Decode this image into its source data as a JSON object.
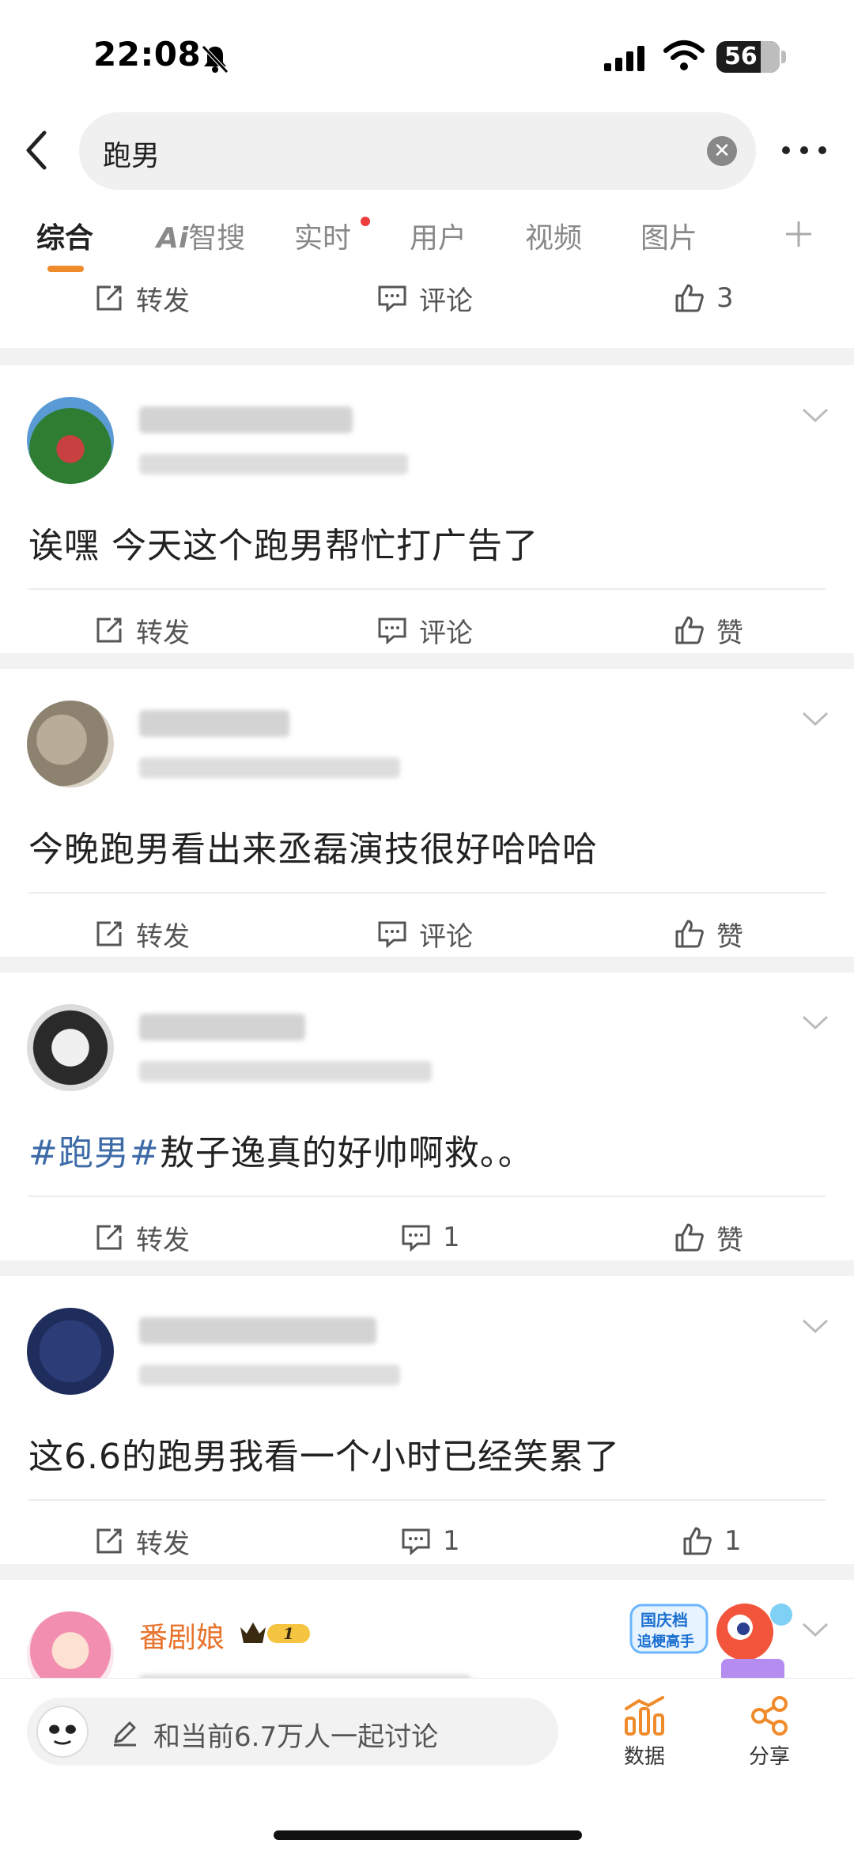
{
  "status": {
    "time": "22:08",
    "battery": "56"
  },
  "search": {
    "query": "跑男"
  },
  "tabs": [
    {
      "label": "综合",
      "active": true
    },
    {
      "label": "Ai智搜",
      "ai_mark": "Ai",
      "rest": "智搜"
    },
    {
      "label": "实时",
      "has_dot": true
    },
    {
      "label": "用户"
    },
    {
      "label": "视频"
    },
    {
      "label": "图片"
    }
  ],
  "actions": {
    "repost": "转发",
    "comment": "评论",
    "like": "赞"
  },
  "partial_card": {
    "like_count": "3"
  },
  "posts": [
    {
      "text": "诶嘿 今天这个跑男帮忙打广告了"
    },
    {
      "text": "今晚跑男看出来丞磊演技很好哈哈哈"
    },
    {
      "hashtag": "#跑男#",
      "text": "敖子逸真的好帅啊救。。",
      "comment_count": "1"
    },
    {
      "text": "这6.6的跑男我看一个小时已经笑累了",
      "comment_count": "1",
      "like_count": "1"
    }
  ],
  "last_post": {
    "name": "番剧娘",
    "vip_level": "1",
    "promo_text_1": "国庆档",
    "promo_text_2": "追梗高手"
  },
  "bottom_bar": {
    "discuss_placeholder": "和当前6.7万人一起讨论",
    "data_label": "数据",
    "share_label": "分享"
  },
  "colors": {
    "accent": "#f08b2b",
    "hashtag": "#3e6ba7",
    "vip_name": "#e8732c"
  },
  "icons": [
    "bell-mute-icon",
    "signal-icon",
    "wifi-icon",
    "back-icon",
    "clear-icon",
    "more-icon",
    "plus-icon",
    "repost-icon",
    "comment-icon",
    "like-icon",
    "chevron-down-icon",
    "pencil-icon",
    "data-chart-icon",
    "share-icon"
  ]
}
